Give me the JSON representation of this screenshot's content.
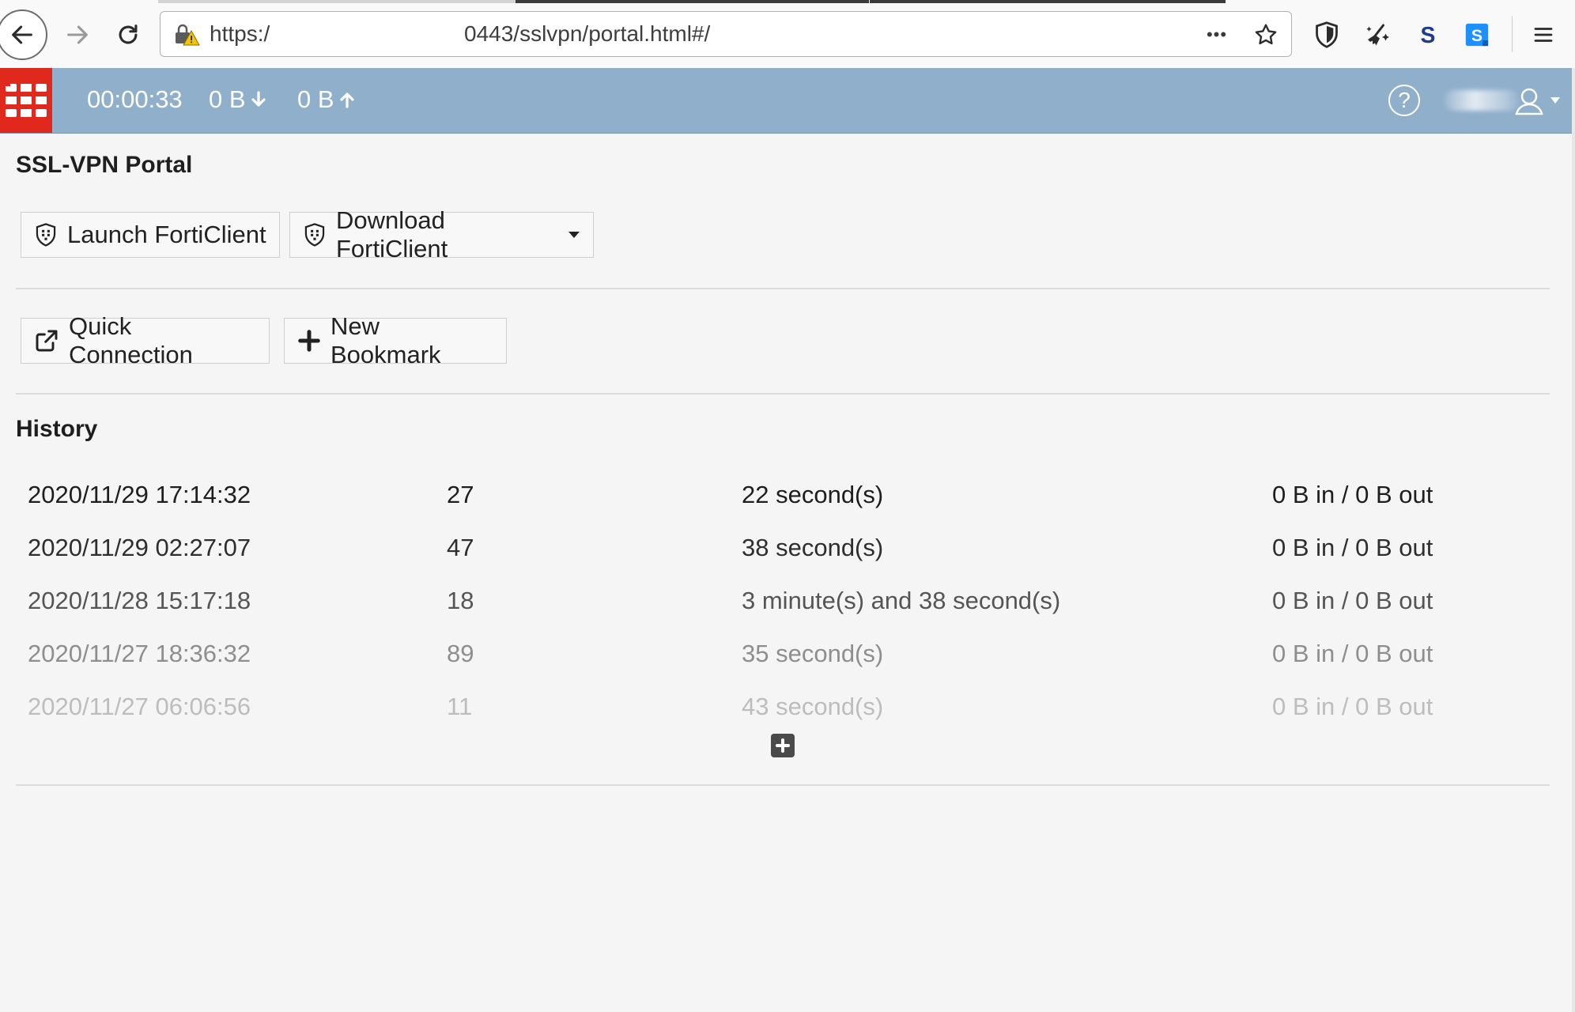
{
  "browser": {
    "url_scheme": "https:/",
    "url_rest": "0443/sslvpn/portal.html#/",
    "more_glyph": "•••"
  },
  "topbar": {
    "session_time": "00:00:33",
    "bytes_down": "0 B",
    "bytes_up": "0 B",
    "help_glyph": "?",
    "brand_color": "#e0291c",
    "bar_color": "#8fafcb"
  },
  "portal": {
    "title": "SSL-VPN Portal",
    "launch_label": "Launch FortiClient",
    "download_label": "Download FortiClient",
    "quick_connection_label": "Quick Connection",
    "new_bookmark_label": "New Bookmark"
  },
  "history": {
    "title": "History",
    "rows": [
      {
        "date": "2020/11/29 17:14:32",
        "count": "27",
        "duration": "22 second(s)",
        "bytes": "0 B in / 0 B out"
      },
      {
        "date": "2020/11/29 02:27:07",
        "count": "47",
        "duration": "38 second(s)",
        "bytes": "0 B in / 0 B out"
      },
      {
        "date": "2020/11/28 15:17:18",
        "count": "18",
        "duration": "3 minute(s) and 38 second(s)",
        "bytes": "0 B in / 0 B out"
      },
      {
        "date": "2020/11/27 18:36:32",
        "count": "89",
        "duration": "35 second(s)",
        "bytes": "0 B in / 0 B out"
      },
      {
        "date": "2020/11/27 06:06:56",
        "count": "11",
        "duration": "43 second(s)",
        "bytes": "0 B in / 0 B out"
      }
    ]
  }
}
